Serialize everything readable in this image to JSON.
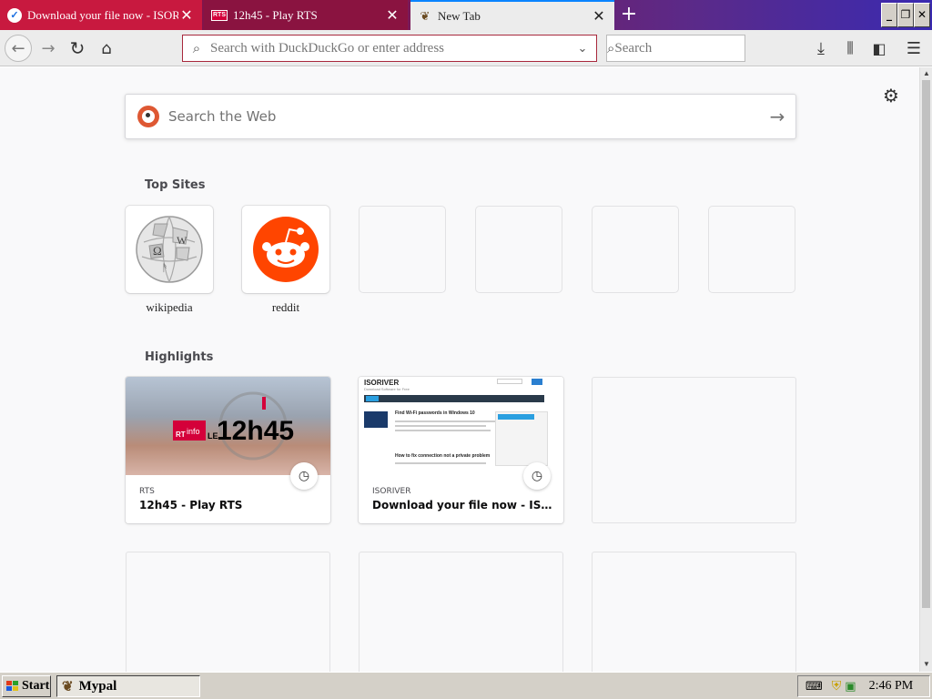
{
  "browser": {
    "tabs": [
      {
        "title": "Download your file now - ISORIVER",
        "favicon": "check-circle-icon",
        "state": "background"
      },
      {
        "title": "12h45 - Play RTS",
        "favicon": "rts-icon",
        "favicon_text": "RTS",
        "state": "background"
      },
      {
        "title": "New Tab",
        "favicon": "mypal-icon",
        "state": "active"
      }
    ],
    "accent_color": "#0a84ff"
  },
  "navbar": {
    "url_placeholder": "Search with DuckDuckGo or enter address",
    "search_placeholder": "Search"
  },
  "newtab": {
    "web_search_placeholder": "Search the Web",
    "top_sites_heading": "Top Sites",
    "top_sites": [
      {
        "label": "wikipedia",
        "icon": "wikipedia-globe-icon"
      },
      {
        "label": "reddit",
        "icon": "reddit-alien-icon"
      }
    ],
    "highlights_heading": "Highlights",
    "highlights": [
      {
        "host": "RTS",
        "title": "12h45 - Play RTS",
        "thumb_text": "12h45",
        "thumb_brand": "RTS",
        "thumb_sub": "info",
        "thumb_le": "LE"
      },
      {
        "host": "ISORIVER",
        "title": "Download your file now - ISORIVER",
        "thumb_brand": "ISORIVER",
        "thumb_tagline": "Download Software for Free",
        "thumb_post_1": "Find Wi-Fi passwords in Windows 10",
        "thumb_post_2": "How to fix connection not a private problem"
      }
    ]
  },
  "taskbar": {
    "start_label": "Start",
    "task_label": "Mypal",
    "clock": "2:46 PM"
  }
}
